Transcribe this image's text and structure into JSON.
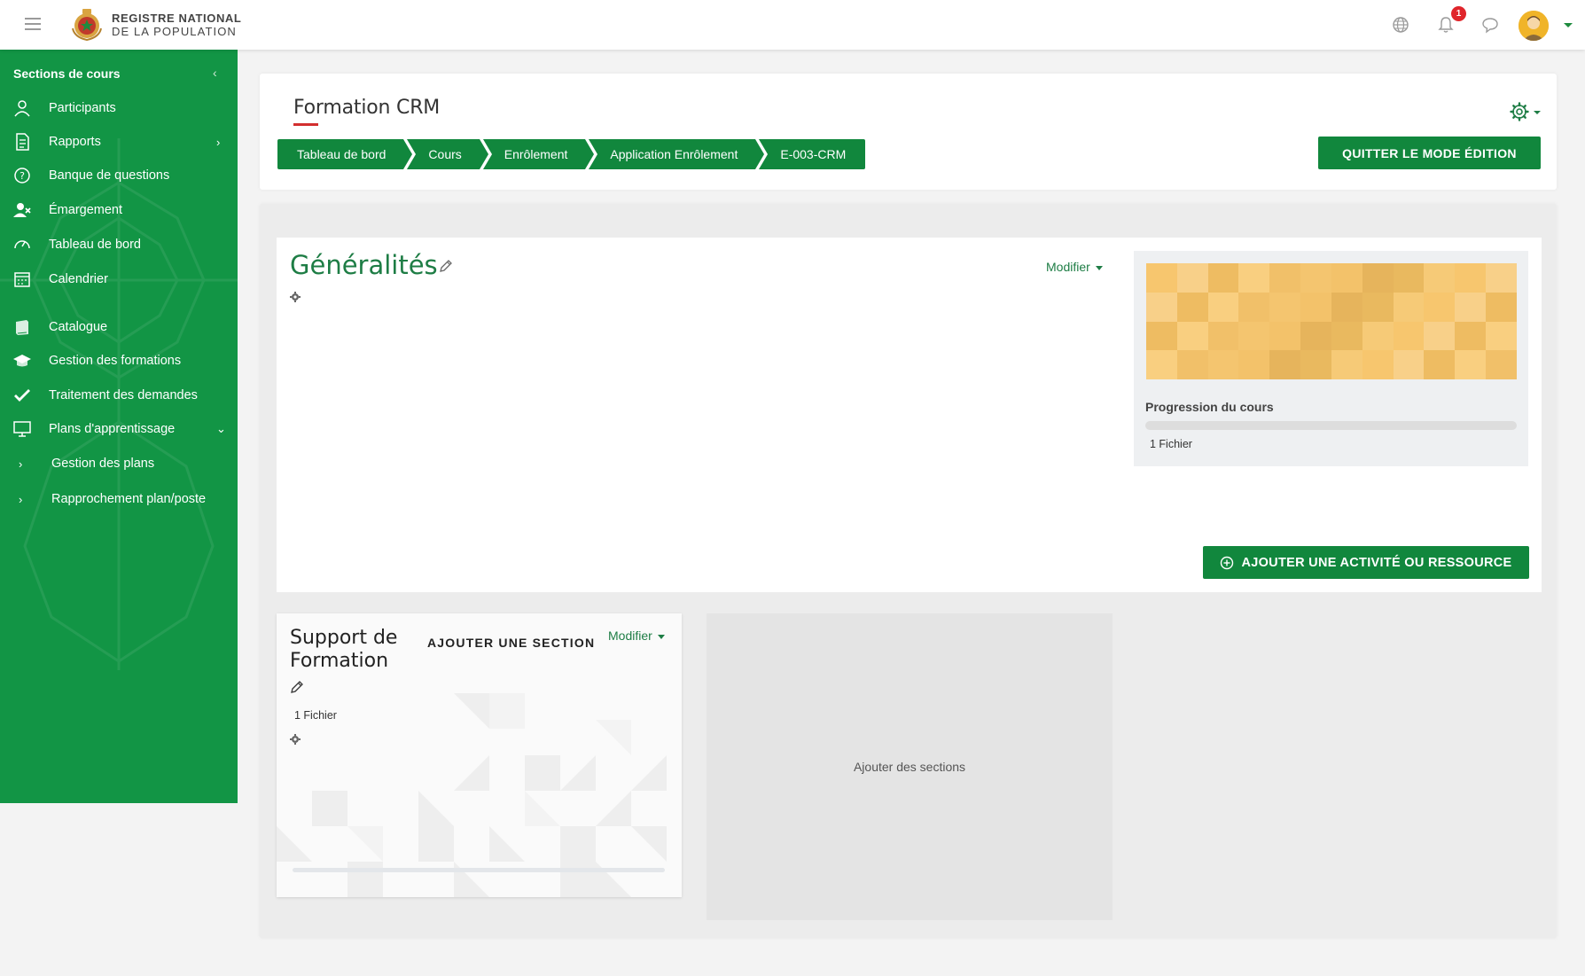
{
  "topbar": {
    "logo_line1": "REGISTRE NATIONAL",
    "logo_line2": "DE LA POPULATION",
    "notification_count": "1",
    "icons": [
      "menu-icon",
      "globe-icon",
      "bell-icon",
      "chat-icon",
      "avatar",
      "chevron-down-icon"
    ]
  },
  "sidebar": {
    "header": "Sections de cours",
    "items": [
      {
        "label": "Participants",
        "icon": "user-icon"
      },
      {
        "label": "Rapports",
        "icon": "document-icon"
      },
      {
        "label": "Banque de questions",
        "icon": "question-icon"
      },
      {
        "label": "Émargement",
        "icon": "user-x-icon"
      },
      {
        "label": "Tableau de bord",
        "icon": "dashboard-icon"
      },
      {
        "label": "Calendrier",
        "icon": "calendar-icon"
      },
      {
        "label": "Catalogue",
        "icon": "book-icon"
      },
      {
        "label": "Gestion des formations",
        "icon": "graduation-cap-icon"
      },
      {
        "label": "Traitement des demandes",
        "icon": "check-icon"
      },
      {
        "label": "Plans d'apprentissage",
        "icon": "monitor-icon"
      }
    ],
    "subitems": [
      {
        "label": "Gestion des plans"
      },
      {
        "label": "Rapprochement plan/poste"
      }
    ]
  },
  "header": {
    "title": "Formation CRM",
    "quit_button": "QUITTER LE MODE ÉDITION",
    "breadcrumb": [
      "Tableau de bord",
      "Cours",
      "Enrôlement",
      "Application Enrôlement",
      "E-003-CRM"
    ]
  },
  "general": {
    "title": "Généralités",
    "modifier": "Modifier",
    "progress_label": "Progression du cours",
    "progress_value": 0,
    "files": "1 Fichier",
    "add_activity": "AJOUTER UNE ACTIVITÉ OU RESSOURCE"
  },
  "section": {
    "title": "Support de Formation",
    "add_section": "AJOUTER UNE SECTION",
    "modifier": "Modifier",
    "files": "1 Fichier"
  },
  "add_sections": {
    "label": "Ajouter des sections"
  },
  "colors": {
    "primary_green": "#11873d",
    "sidebar_green": "#129545",
    "title_green": "#1e7d45",
    "accent_red": "#d32f2f"
  }
}
